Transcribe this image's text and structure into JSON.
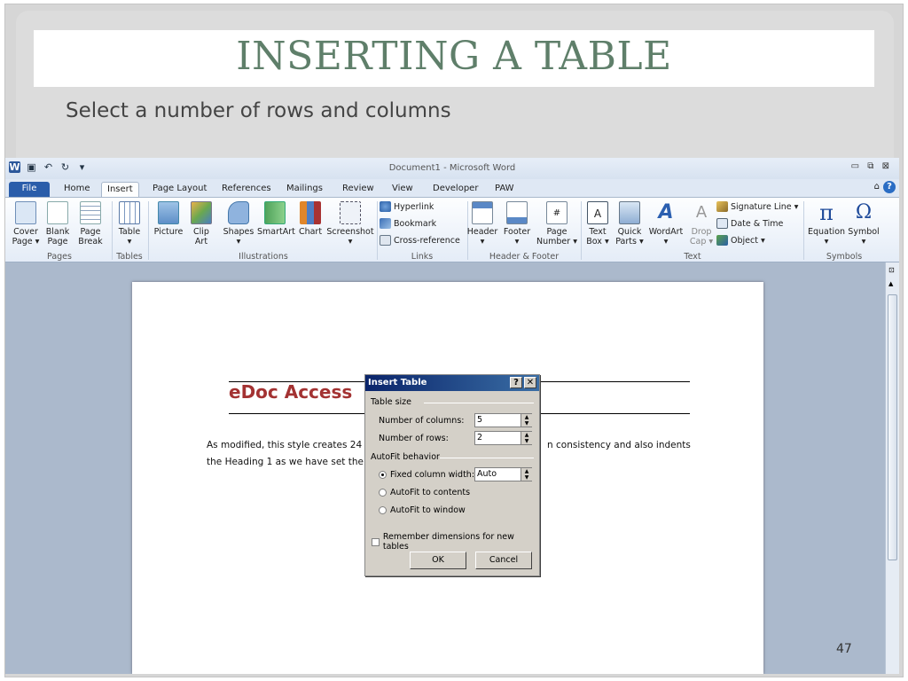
{
  "slide": {
    "title": "INSERTING A TABLE",
    "subtitle": "Select a number of rows and columns",
    "number": "47"
  },
  "window": {
    "title": "Document1 - Microsoft Word",
    "controls": "▭ ⧉ ⊠"
  },
  "tabs": [
    "File",
    "Home",
    "Insert",
    "Page Layout",
    "References",
    "Mailings",
    "Review",
    "View",
    "Developer",
    "PAW"
  ],
  "ribbon": {
    "pages": {
      "cover": "Cover\nPage ▾",
      "blank": "Blank\nPage",
      "break": "Page\nBreak",
      "label": "Pages"
    },
    "tables": {
      "table": "Table\n▾",
      "label": "Tables"
    },
    "illustrations": {
      "picture": "Picture",
      "clipart": "Clip\nArt",
      "shapes": "Shapes\n▾",
      "smartart": "SmartArt",
      "chart": "Chart",
      "screenshot": "Screenshot\n▾",
      "label": "Illustrations"
    },
    "links": {
      "hyperlink": "Hyperlink",
      "bookmark": "Bookmark",
      "crossref": "Cross-reference",
      "label": "Links"
    },
    "headerfooter": {
      "header": "Header\n▾",
      "footer": "Footer\n▾",
      "pagenumber": "Page\nNumber ▾",
      "label": "Header & Footer"
    },
    "text": {
      "textbox": "Text\nBox ▾",
      "quickparts": "Quick\nParts ▾",
      "wordart": "WordArt\n▾",
      "dropcap": "Drop\nCap ▾",
      "signature": "Signature Line ▾",
      "datetime": "Date & Time",
      "object": "Object ▾",
      "label": "Text"
    },
    "symbols": {
      "equation": "Equation\n▾",
      "symbol": "Symbol\n▾",
      "label": "Symbols"
    }
  },
  "document": {
    "heading": "eDoc Access",
    "line1a": "As modified, this style creates 24 p",
    "line1b": "n consistency and also indents",
    "line2": "the Heading 1 as we have set the p"
  },
  "dialog": {
    "title": "Insert Table",
    "help": "?",
    "close": "✕",
    "table_size": "Table size",
    "columns_label": "Number of columns:",
    "columns_value": "5",
    "rows_label": "Number of rows:",
    "rows_value": "2",
    "autofit": "AutoFit behavior",
    "fixed": "Fixed column width:",
    "fixed_value": "Auto",
    "contents": "AutoFit to contents",
    "window": "AutoFit to window",
    "remember": "Remember dimensions for new tables",
    "ok": "OK",
    "cancel": "Cancel"
  }
}
